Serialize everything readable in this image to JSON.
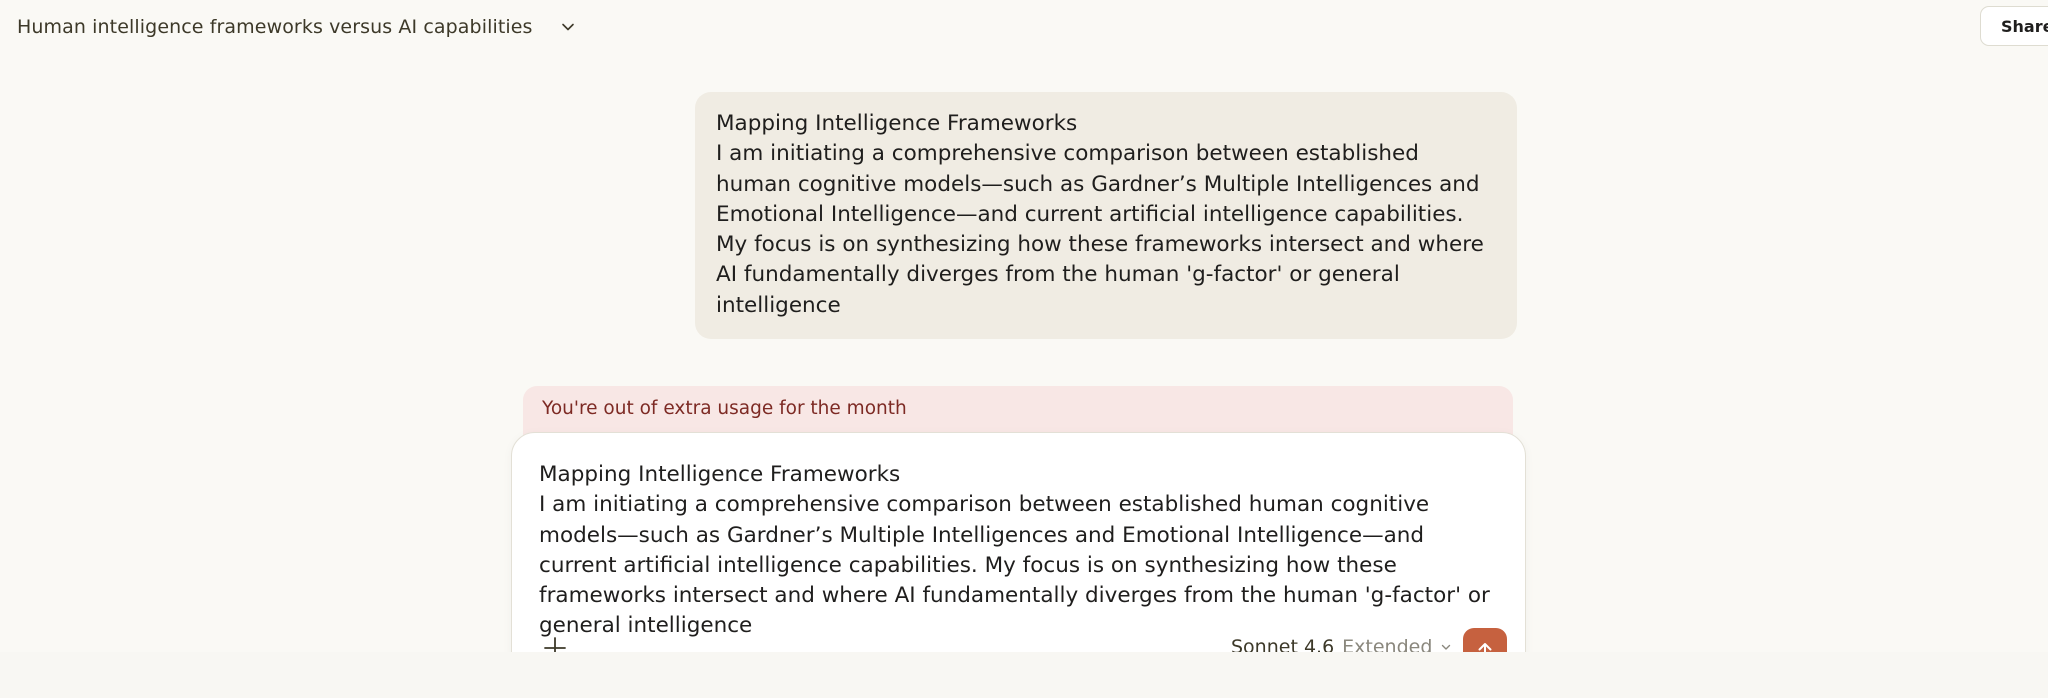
{
  "header": {
    "title": "Human intelligence frameworks versus AI capabilities",
    "chevron_icon": "chevron-down-icon",
    "share_label": "Share"
  },
  "conversation": {
    "user_message": {
      "heading": "Mapping Intelligence Frameworks",
      "body": "I am initiating a comprehensive comparison between established human cognitive models—such as Gardner’s Multiple Intelligences and Emotional Intelligence—and current artificial intelligence capabilities. My focus is on synthesizing how these frameworks intersect and where AI fundamentally diverges from the human 'g-factor' or general intelligence"
    }
  },
  "usage_banner": {
    "text": "You're out of extra usage for the month"
  },
  "composer": {
    "heading": "Mapping Intelligence Frameworks",
    "body": "I am initiating a comprehensive comparison between established human cognitive models—such as Gardner’s Multiple Intelligences and Emotional Intelligence—and current artificial intelligence capabilities. My focus is on synthesizing how these frameworks intersect and where AI fundamentally diverges from the human 'g-factor' or general intelligence",
    "model_name": "Sonnet 4.6",
    "model_mode": "Extended",
    "plus_icon": "plus-icon",
    "send_icon": "arrow-up-icon"
  },
  "colors": {
    "background": "#faf9f5",
    "user_bubble": "#f0ece3",
    "banner_bg": "#f8e7e5",
    "banner_text": "#7d2a24",
    "send_button": "#c6613f"
  }
}
